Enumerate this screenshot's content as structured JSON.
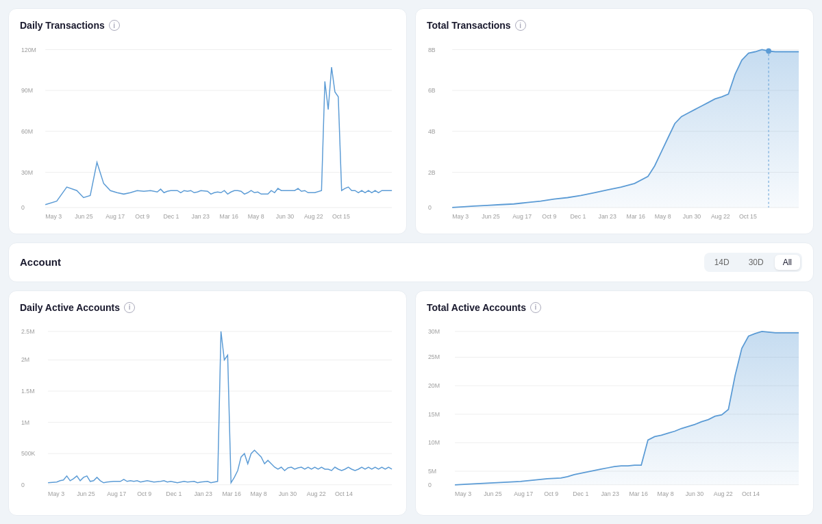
{
  "section1": {
    "left": {
      "title": "Daily Transactions",
      "yLabels": [
        "120M",
        "90M",
        "60M",
        "30M",
        "0"
      ],
      "xLabels": [
        "May 3",
        "Jun 25",
        "Aug 17",
        "Oct 9",
        "Dec 1",
        "Jan 23",
        "Mar 16",
        "May 8",
        "Jun 30",
        "Aug 22",
        "Oct 15"
      ]
    },
    "right": {
      "title": "Total Transactions",
      "yLabels": [
        "8B",
        "6B",
        "4B",
        "2B",
        "0"
      ],
      "xLabels": [
        "May 3",
        "Jun 25",
        "Aug 17",
        "Oct 9",
        "Dec 1",
        "Jan 23",
        "Mar 16",
        "May 8",
        "Jun 30",
        "Aug 22",
        "Oct 15"
      ]
    }
  },
  "section2": {
    "title": "Account",
    "buttons": [
      "14D",
      "30D",
      "All"
    ],
    "activeButton": "All",
    "left": {
      "title": "Daily Active Accounts",
      "yLabels": [
        "2.5M",
        "2M",
        "1.5M",
        "1M",
        "500K",
        "0"
      ],
      "xLabels": [
        "May 3",
        "Jun 25",
        "Aug 17",
        "Oct 9",
        "Dec 1",
        "Jan 23",
        "Mar 16",
        "May 8",
        "Jun 30",
        "Aug 22",
        "Oct 14"
      ]
    },
    "right": {
      "title": "Total Active Accounts",
      "yLabels": [
        "30M",
        "25M",
        "20M",
        "15M",
        "10M",
        "5M",
        "0"
      ],
      "xLabels": [
        "May 3",
        "Jun 25",
        "Aug 17",
        "Oct 9",
        "Dec 1",
        "Jan 23",
        "Mar 16",
        "May 8",
        "Jun 30",
        "Aug 22",
        "Oct 14"
      ]
    }
  },
  "colors": {
    "accent": "#5b9bd5",
    "accentFill": "rgba(91,155,213,0.2)",
    "accentFillLight": "rgba(91,155,213,0.15)"
  },
  "info_icon_label": "i"
}
